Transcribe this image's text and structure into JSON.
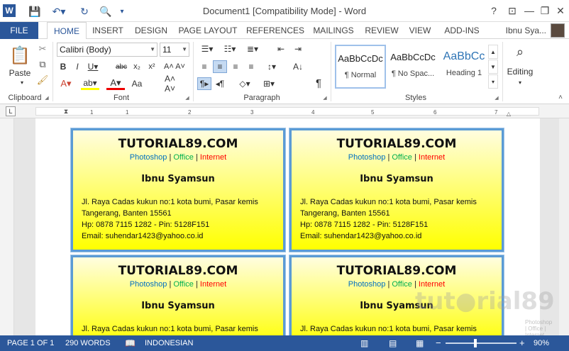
{
  "titlebar": {
    "app_letter": "W",
    "title": "Document1 [Compatibility Mode] - Word",
    "help_label": "?",
    "minimize_label": "—",
    "restore_label": "❐",
    "close_label": "✕"
  },
  "tabs": [
    "FILE",
    "HOME",
    "INSERT",
    "DESIGN",
    "PAGE LAYOUT",
    "REFERENCES",
    "MAILINGS",
    "REVIEW",
    "VIEW",
    "ADD-INS"
  ],
  "user_name": "Ibnu Sya...",
  "ribbon": {
    "paste_label": "Paste",
    "font_name": "Calibri (Body)",
    "font_size": "11",
    "styles": [
      {
        "sample": "AaBbCcDc",
        "name": "¶ Normal"
      },
      {
        "sample": "AaBbCcDc",
        "name": "¶ No Spac..."
      },
      {
        "sample": "AaBbCc",
        "name": "Heading 1"
      }
    ],
    "editing_label": "Editing",
    "groups": {
      "clipboard": "Clipboard",
      "font": "Font",
      "paragraph": "Paragraph",
      "styles": "Styles"
    }
  },
  "ruler": {
    "numbers": [
      "1",
      "1",
      "2",
      "3",
      "4",
      "5",
      "6",
      "7"
    ]
  },
  "cards": [
    {
      "title": "TUTORIAL89.COM",
      "link1": "Photoshop",
      "link2": "Office",
      "link3": "Internet",
      "sep": "|",
      "name": "Ibnu Syamsun",
      "addr1": "Jl. Raya Cadas kukun no:1 kota bumi, Pasar kemis",
      "addr2": "Tangerang, Banten 15561",
      "phone": "Hp: 0878 7115 1282 - Pin: 5128F151",
      "email": "Email: suhendar1423@yahoo.co.id"
    },
    {
      "title": "TUTORIAL89.COM",
      "link1": "Photoshop",
      "link2": "Office",
      "link3": "Internet",
      "sep": "|",
      "name": "Ibnu Syamsun",
      "addr1": "Jl. Raya Cadas kukun no:1 kota bumi, Pasar kemis",
      "addr2": "Tangerang, Banten 15561",
      "phone": "Hp: 0878 7115 1282 - Pin: 5128F151",
      "email": "Email: suhendar1423@yahoo.co.id"
    },
    {
      "title": "TUTORIAL89.COM",
      "link1": "Photoshop",
      "link2": "Office",
      "link3": "Internet",
      "sep": "|",
      "name": "Ibnu Syamsun",
      "addr1": "Jl. Raya Cadas kukun no:1 kota bumi, Pasar kemis"
    },
    {
      "title": "TUTORIAL89.COM",
      "link1": "Photoshop",
      "link2": "Office",
      "link3": "Internet",
      "sep": "|",
      "name": "Ibnu Syamsun",
      "addr1": "Jl. Raya Cadas kukun no:1 kota bumi, Pasar kemis"
    }
  ],
  "watermark": {
    "text": "tut●rial89",
    "sub": "Photoshop | Office | Internet"
  },
  "status": {
    "page": "PAGE 1 OF 1",
    "words": "290 WORDS",
    "language": "INDONESIAN",
    "zoom": "90%",
    "zoom_minus": "−",
    "zoom_plus": "+"
  },
  "colors": {
    "accent": "#2b579a",
    "card_border": "#5b9bd5",
    "link1": "#0070c0",
    "link2": "#00b050",
    "link3": "#ff0000"
  }
}
